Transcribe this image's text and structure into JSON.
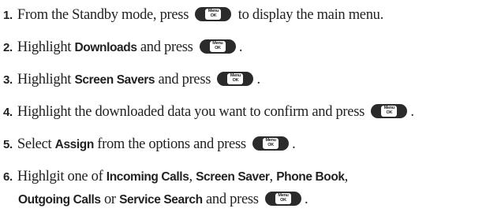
{
  "key": {
    "top": "Menu",
    "bottom": "OK",
    "icon": "menu-ok-key-icon"
  },
  "steps": [
    {
      "num": "1.",
      "t1": "From the Standby mode, press",
      "t2": "to display the main menu."
    },
    {
      "num": "2.",
      "t1": "Highlight",
      "b1": "Downloads",
      "t2": "and press",
      "t3": "."
    },
    {
      "num": "3.",
      "t1": "Highlight",
      "b1": "Screen Savers",
      "t2": "and press",
      "t3": "."
    },
    {
      "num": "4.",
      "t1": "Highlight the downloaded data you want to confirm and press",
      "t2": "."
    },
    {
      "num": "5.",
      "t1": "Select",
      "b1": "Assign",
      "t2": "from the options and press",
      "t3": "."
    },
    {
      "num": "6.",
      "t1": "Highlgit one of",
      "b1": "Incoming Calls",
      "s1": ",",
      "b2": "Screen Saver",
      "s2": ",",
      "b3": "Phone Book",
      "s3": ",",
      "b4": "Outgoing Calls",
      "t2": "or",
      "b5": "Service Search",
      "t3": "and press",
      "t4": "."
    }
  ]
}
